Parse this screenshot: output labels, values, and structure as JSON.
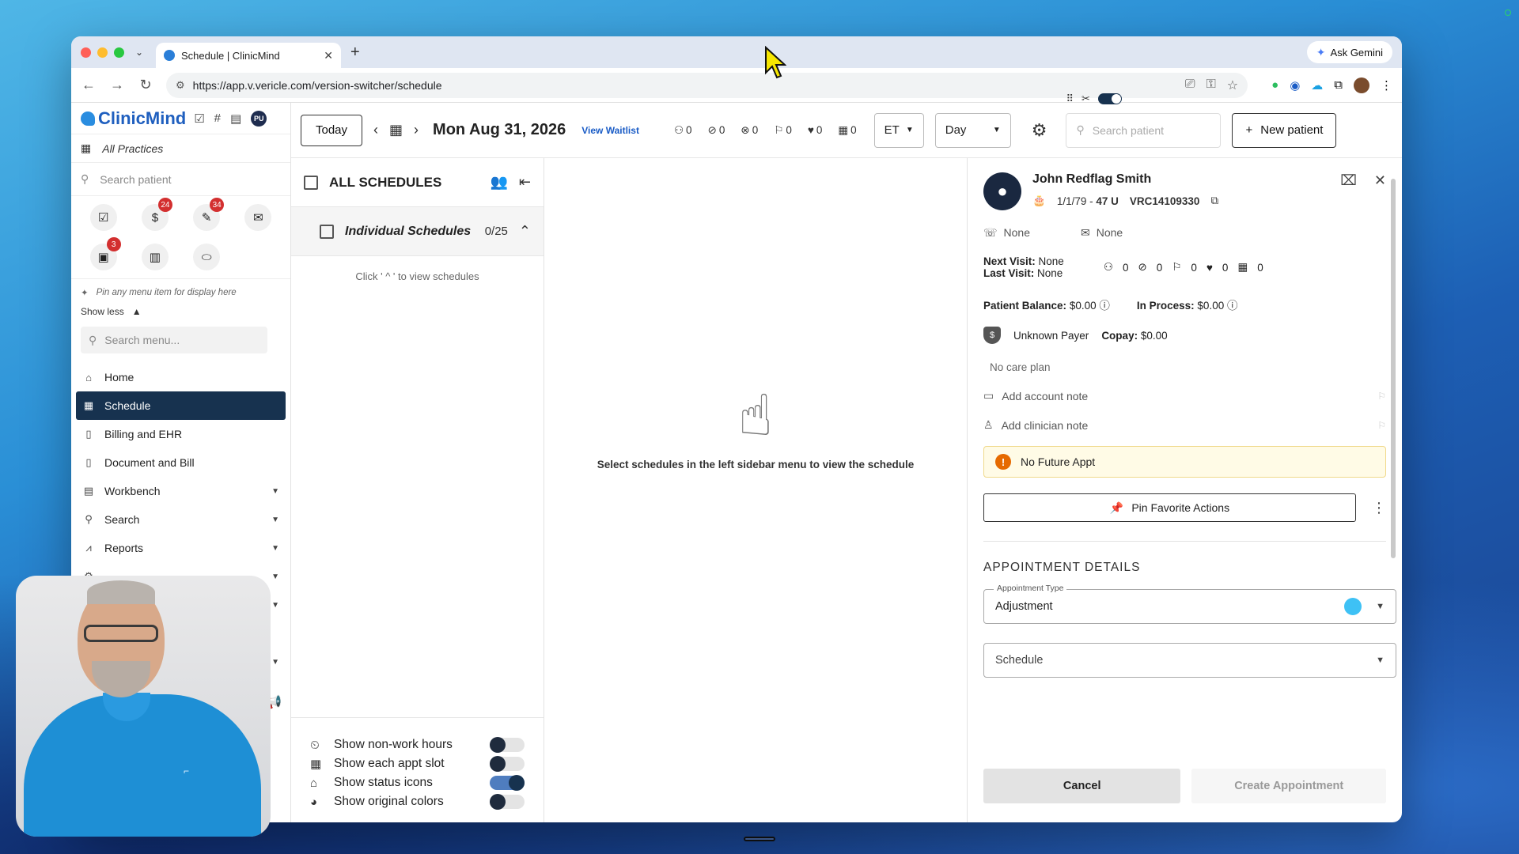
{
  "browser": {
    "tab_title": "Schedule | ClinicMind",
    "url": "https://app.v.vericle.com/version-switcher/schedule",
    "ask_gemini": "Ask Gemini",
    "new_tab": "+",
    "close_tab": "✕"
  },
  "sidebar": {
    "logo": "ClinicMind",
    "user_initials": "PU",
    "practice": "All Practices",
    "search_placeholder": "Search patient",
    "quick_icons": [
      {
        "icon": "tasks-icon",
        "badge": ""
      },
      {
        "icon": "dollar-icon",
        "badge": "24"
      },
      {
        "icon": "pen-icon",
        "badge": "34"
      },
      {
        "icon": "mail-icon",
        "badge": ""
      },
      {
        "icon": "id-card-icon",
        "badge": "3"
      },
      {
        "icon": "briefcase-icon",
        "badge": ""
      },
      {
        "icon": "pill-icon",
        "badge": ""
      }
    ],
    "pin_hint": "Pin any menu item for display here",
    "show_less": "Show less",
    "menu_search_placeholder": "Search menu...",
    "menu": [
      {
        "label": "Home",
        "icon": "home-icon",
        "caret": false,
        "active": false
      },
      {
        "label": "Schedule",
        "icon": "calendar-icon",
        "caret": false,
        "active": true
      },
      {
        "label": "Billing and EHR",
        "icon": "document-icon",
        "caret": false,
        "active": false
      },
      {
        "label": "Document and Bill",
        "icon": "document-icon",
        "caret": false,
        "active": false
      },
      {
        "label": "Workbench",
        "icon": "table-icon",
        "caret": true,
        "active": false
      },
      {
        "label": "Search",
        "icon": "search-icon",
        "caret": true,
        "active": false
      },
      {
        "label": "Reports",
        "icon": "chart-icon",
        "caret": true,
        "active": false
      }
    ]
  },
  "toolbar": {
    "today": "Today",
    "date": "Mon Aug 31, 2026",
    "view_waitlist": "View Waitlist",
    "stats": [
      "0",
      "0",
      "0",
      "0",
      "0",
      "0"
    ],
    "timezone": "ET",
    "view": "Day",
    "search_placeholder": "Search patient",
    "new_patient": "New patient"
  },
  "schedules": {
    "all_title": "ALL SCHEDULES",
    "individual_label": "Individual Schedules",
    "individual_count": "0/25",
    "hint": "Click ' ^ ' to view schedules",
    "toggles": [
      {
        "label": "Show non-work hours",
        "on": false
      },
      {
        "label": "Show each appt slot",
        "on": false
      },
      {
        "label": "Show status icons",
        "on": true
      },
      {
        "label": "Show original colors",
        "on": false
      }
    ]
  },
  "main": {
    "empty_text": "Select schedules in the left sidebar menu to view the schedule"
  },
  "patient": {
    "name": "John Redflag Smith",
    "dob_age": "1/1/79 - ",
    "age": "47 U",
    "id": "VRC14109330",
    "phone": "None",
    "email": "None",
    "next_visit_label": "Next Visit:",
    "next_visit": "None",
    "last_visit_label": "Last Visit:",
    "last_visit": "None",
    "visit_stats": [
      "0",
      "0",
      "0",
      "0",
      "0"
    ],
    "balance_label": "Patient Balance:",
    "balance": "$0.00",
    "in_process_label": "In Process:",
    "in_process": "$0.00",
    "payer": "Unknown Payer",
    "copay_label": "Copay:",
    "copay": "$0.00",
    "care_plan": "No care plan",
    "account_note": "Add account note",
    "clinician_note": "Add clinician note",
    "future_appt": "No Future Appt",
    "pin_actions": "Pin Favorite Actions"
  },
  "appointment": {
    "heading": "APPOINTMENT DETAILS",
    "type_legend": "Appointment Type",
    "type_value": "Adjustment",
    "type_color": "#3ec1f5",
    "schedule_placeholder": "Schedule",
    "cancel": "Cancel",
    "create": "Create Appointment"
  }
}
